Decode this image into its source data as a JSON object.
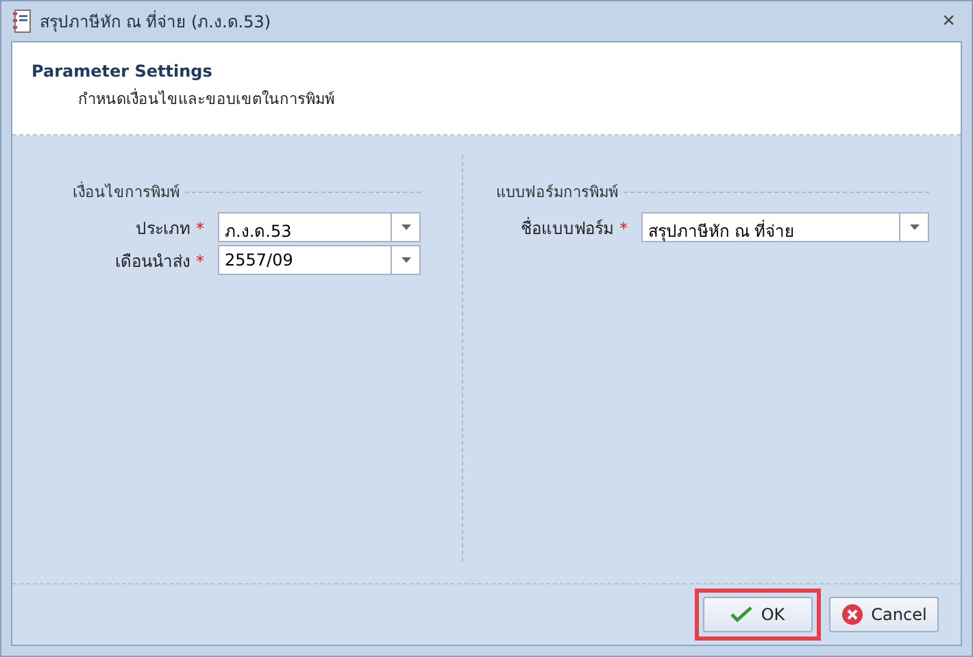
{
  "window": {
    "title": "สรุปภาษีหัก ณ ที่จ่าย (ภ.ง.ด.53)",
    "close": "×"
  },
  "header": {
    "title": "Parameter Settings",
    "subtitle": "กำหนดเงื่อนไขและขอบเขตในการพิมพ์"
  },
  "groups": [
    {
      "title": "เงื่อนไขการพิมพ์",
      "fields": [
        {
          "label": "ประเภท",
          "required_mark": "*",
          "value": "ภ.ง.ด.53"
        },
        {
          "label": "เดือนนำส่ง",
          "required_mark": "*",
          "value": "2557/09"
        }
      ]
    },
    {
      "title": "แบบฟอร์มการพิมพ์",
      "fields": [
        {
          "label": "ชื่อแบบฟอร์ม",
          "required_mark": "*",
          "value": "สรุปภาษีหัก ณ ที่จ่าย"
        }
      ]
    }
  ],
  "buttons": [
    {
      "kind": "ok",
      "label": "OK",
      "highlighted": true
    },
    {
      "kind": "cancel",
      "label": "Cancel",
      "highlighted": false
    }
  ]
}
